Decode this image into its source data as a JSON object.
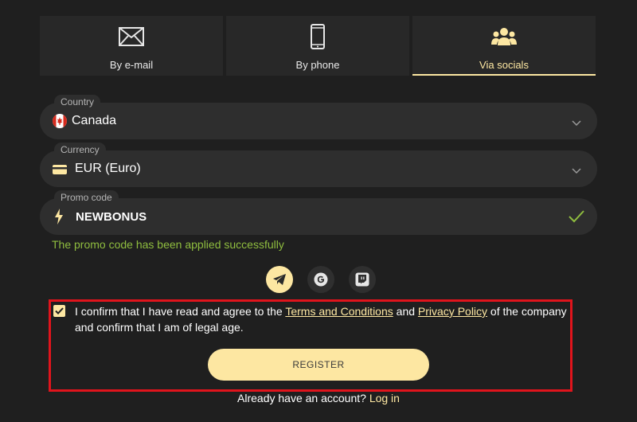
{
  "tabs": [
    {
      "label": "By e-mail",
      "icon": "envelope-icon"
    },
    {
      "label": "By phone",
      "icon": "phone-icon"
    },
    {
      "label": "Via socials",
      "icon": "users-icon",
      "active": true
    }
  ],
  "country": {
    "legend": "Country",
    "value": "Canada",
    "icon": "canada-flag-icon"
  },
  "currency": {
    "legend": "Currency",
    "value": "EUR (Euro)",
    "icon": "card-icon"
  },
  "promo": {
    "legend": "Promo code",
    "value": "NEWBONUS",
    "icon": "lightning-icon",
    "status_icon": "checkmark-icon"
  },
  "promo_success": "The promo code has been applied successfully",
  "socials": [
    {
      "name": "telegram",
      "icon": "telegram-icon"
    },
    {
      "name": "google",
      "icon": "google-icon"
    },
    {
      "name": "twitch",
      "icon": "twitch-icon"
    }
  ],
  "confirm": {
    "checked": true,
    "text_1": "I confirm that I have read and agree to the ",
    "terms_link": "Terms and Conditions",
    "text_2": " and ",
    "privacy_link": "Privacy Policy",
    "text_3": " of the company and confirm that I am of legal age."
  },
  "register_label": "REGISTER",
  "login": {
    "prompt": "Already have an account? ",
    "link": "Log in"
  },
  "colors": {
    "background": "#1f1f1f",
    "accent": "#fde7a2",
    "success": "#8fbd3f",
    "highlight": "#e0141c"
  }
}
